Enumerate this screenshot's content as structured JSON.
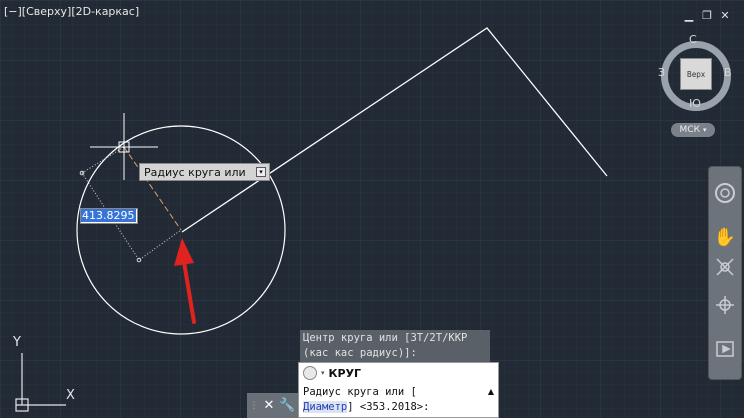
{
  "viewport": {
    "label": "[−][Сверху][2D-каркас]"
  },
  "window_controls": {
    "minimize": "▁",
    "restore": "❐",
    "close": "✕"
  },
  "viewcube": {
    "face": "Верх",
    "north": "С",
    "south": "Ю",
    "west": "З",
    "east": "В",
    "ucs": "МСК"
  },
  "tooltip": {
    "text": "Радиус круга или"
  },
  "dynamic_input": {
    "value": "413.8295"
  },
  "command_history": {
    "line1": "Центр круга или [3Т/2Т/ККР",
    "line2": "(кас кас радиус)]:"
  },
  "command_line": {
    "command_name": "КРУГ",
    "prompt_line1": "Радиус круга или [",
    "option": "Диаметр",
    "prompt_tail": "] <353.2018>:"
  },
  "ucs_icon": {
    "y_label": "Y",
    "x_label": "X"
  },
  "colors": {
    "background": "#222a35",
    "grid_minor": "#2b3340",
    "grid_major": "#323b49",
    "geometry": "#ffffff",
    "rubber_band": "#e0a060",
    "arrow": "#e0231e"
  },
  "icons": {
    "nav_steering": "steeringwheel-icon",
    "nav_pan": "pan-hand-icon",
    "nav_zoom": "zoom-extents-icon",
    "nav_orbit": "orbit-icon",
    "nav_showmotion": "showmotion-icon"
  }
}
